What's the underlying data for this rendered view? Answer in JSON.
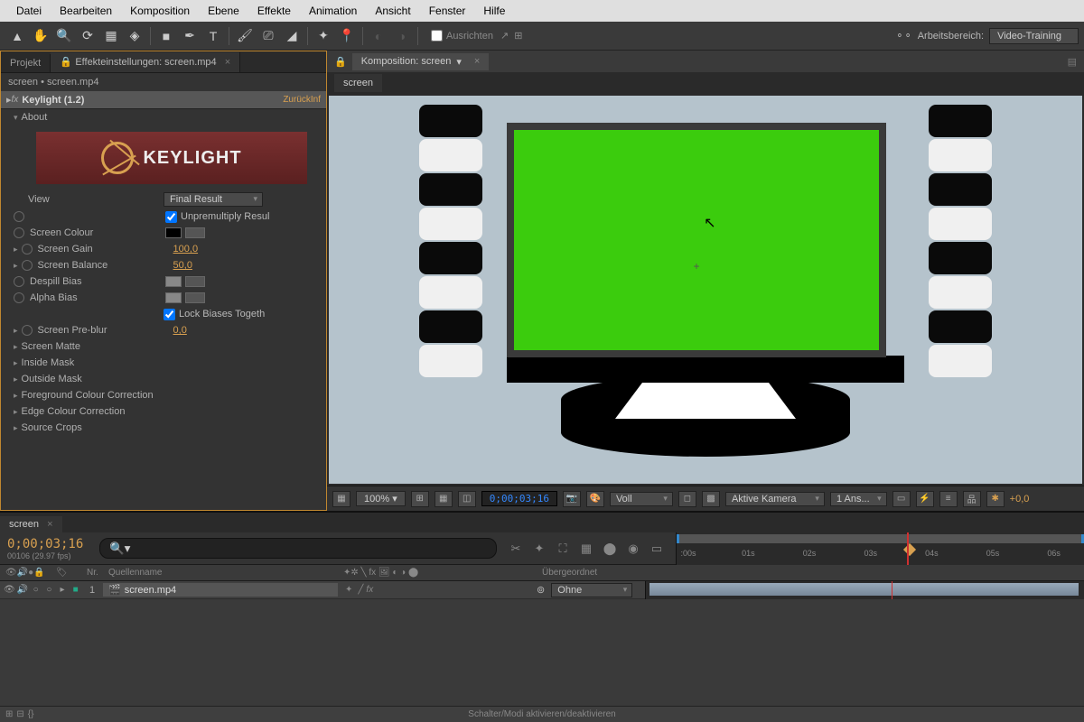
{
  "menu": [
    "Datei",
    "Bearbeiten",
    "Komposition",
    "Ebene",
    "Effekte",
    "Animation",
    "Ansicht",
    "Fenster",
    "Hilfe"
  ],
  "toolbar": {
    "align_label": "Ausrichten",
    "workspace_label": "Arbeitsbereich:",
    "workspace_value": "Video-Training"
  },
  "left": {
    "tab_project": "Projekt",
    "tab_effect": "Effekteinstellungen: screen.mp4",
    "path": "screen • screen.mp4",
    "effect_name": "Keylight (1.2)",
    "reset": "Zurück",
    "info": "Inf",
    "about": "About",
    "logo_text": "KEYLIGHT",
    "props": {
      "view_label": "View",
      "view_value": "Final Result",
      "unpremult": "Unpremultiply Resul",
      "screen_colour": "Screen Colour",
      "screen_gain": "Screen Gain",
      "screen_gain_v": "100,0",
      "screen_balance": "Screen Balance",
      "screen_balance_v": "50,0",
      "despill": "Despill Bias",
      "alpha": "Alpha Bias",
      "lock": "Lock Biases Togeth",
      "preblur": "Screen Pre-blur",
      "preblur_v": "0,0",
      "matte": "Screen Matte",
      "inside": "Inside Mask",
      "outside": "Outside Mask",
      "fgcc": "Foreground Colour Correction",
      "edgecc": "Edge Colour Correction",
      "crops": "Source Crops"
    }
  },
  "comp": {
    "tab_label": "Komposition: screen",
    "subtab": "screen"
  },
  "vp_toolbar": {
    "zoom": "100%",
    "timecode": "0;00;03;16",
    "res": "Voll",
    "camera": "Aktive Kamera",
    "views": "1 Ans...",
    "exposure": "+0,0"
  },
  "timeline": {
    "tab": "screen",
    "timecode": "0;00;03;16",
    "frame_info": "00106 (29.97 fps)",
    "col_nr": "Nr.",
    "col_source": "Quellenname",
    "col_parent": "Übergeordnet",
    "layer_num": "1",
    "layer_name": "screen.mp4",
    "parent_value": "Ohne",
    "ticks": [
      ":00s",
      "01s",
      "02s",
      "03s",
      "04s",
      "05s",
      "06s"
    ]
  },
  "status": "Schalter/Modi aktivieren/deaktivieren"
}
